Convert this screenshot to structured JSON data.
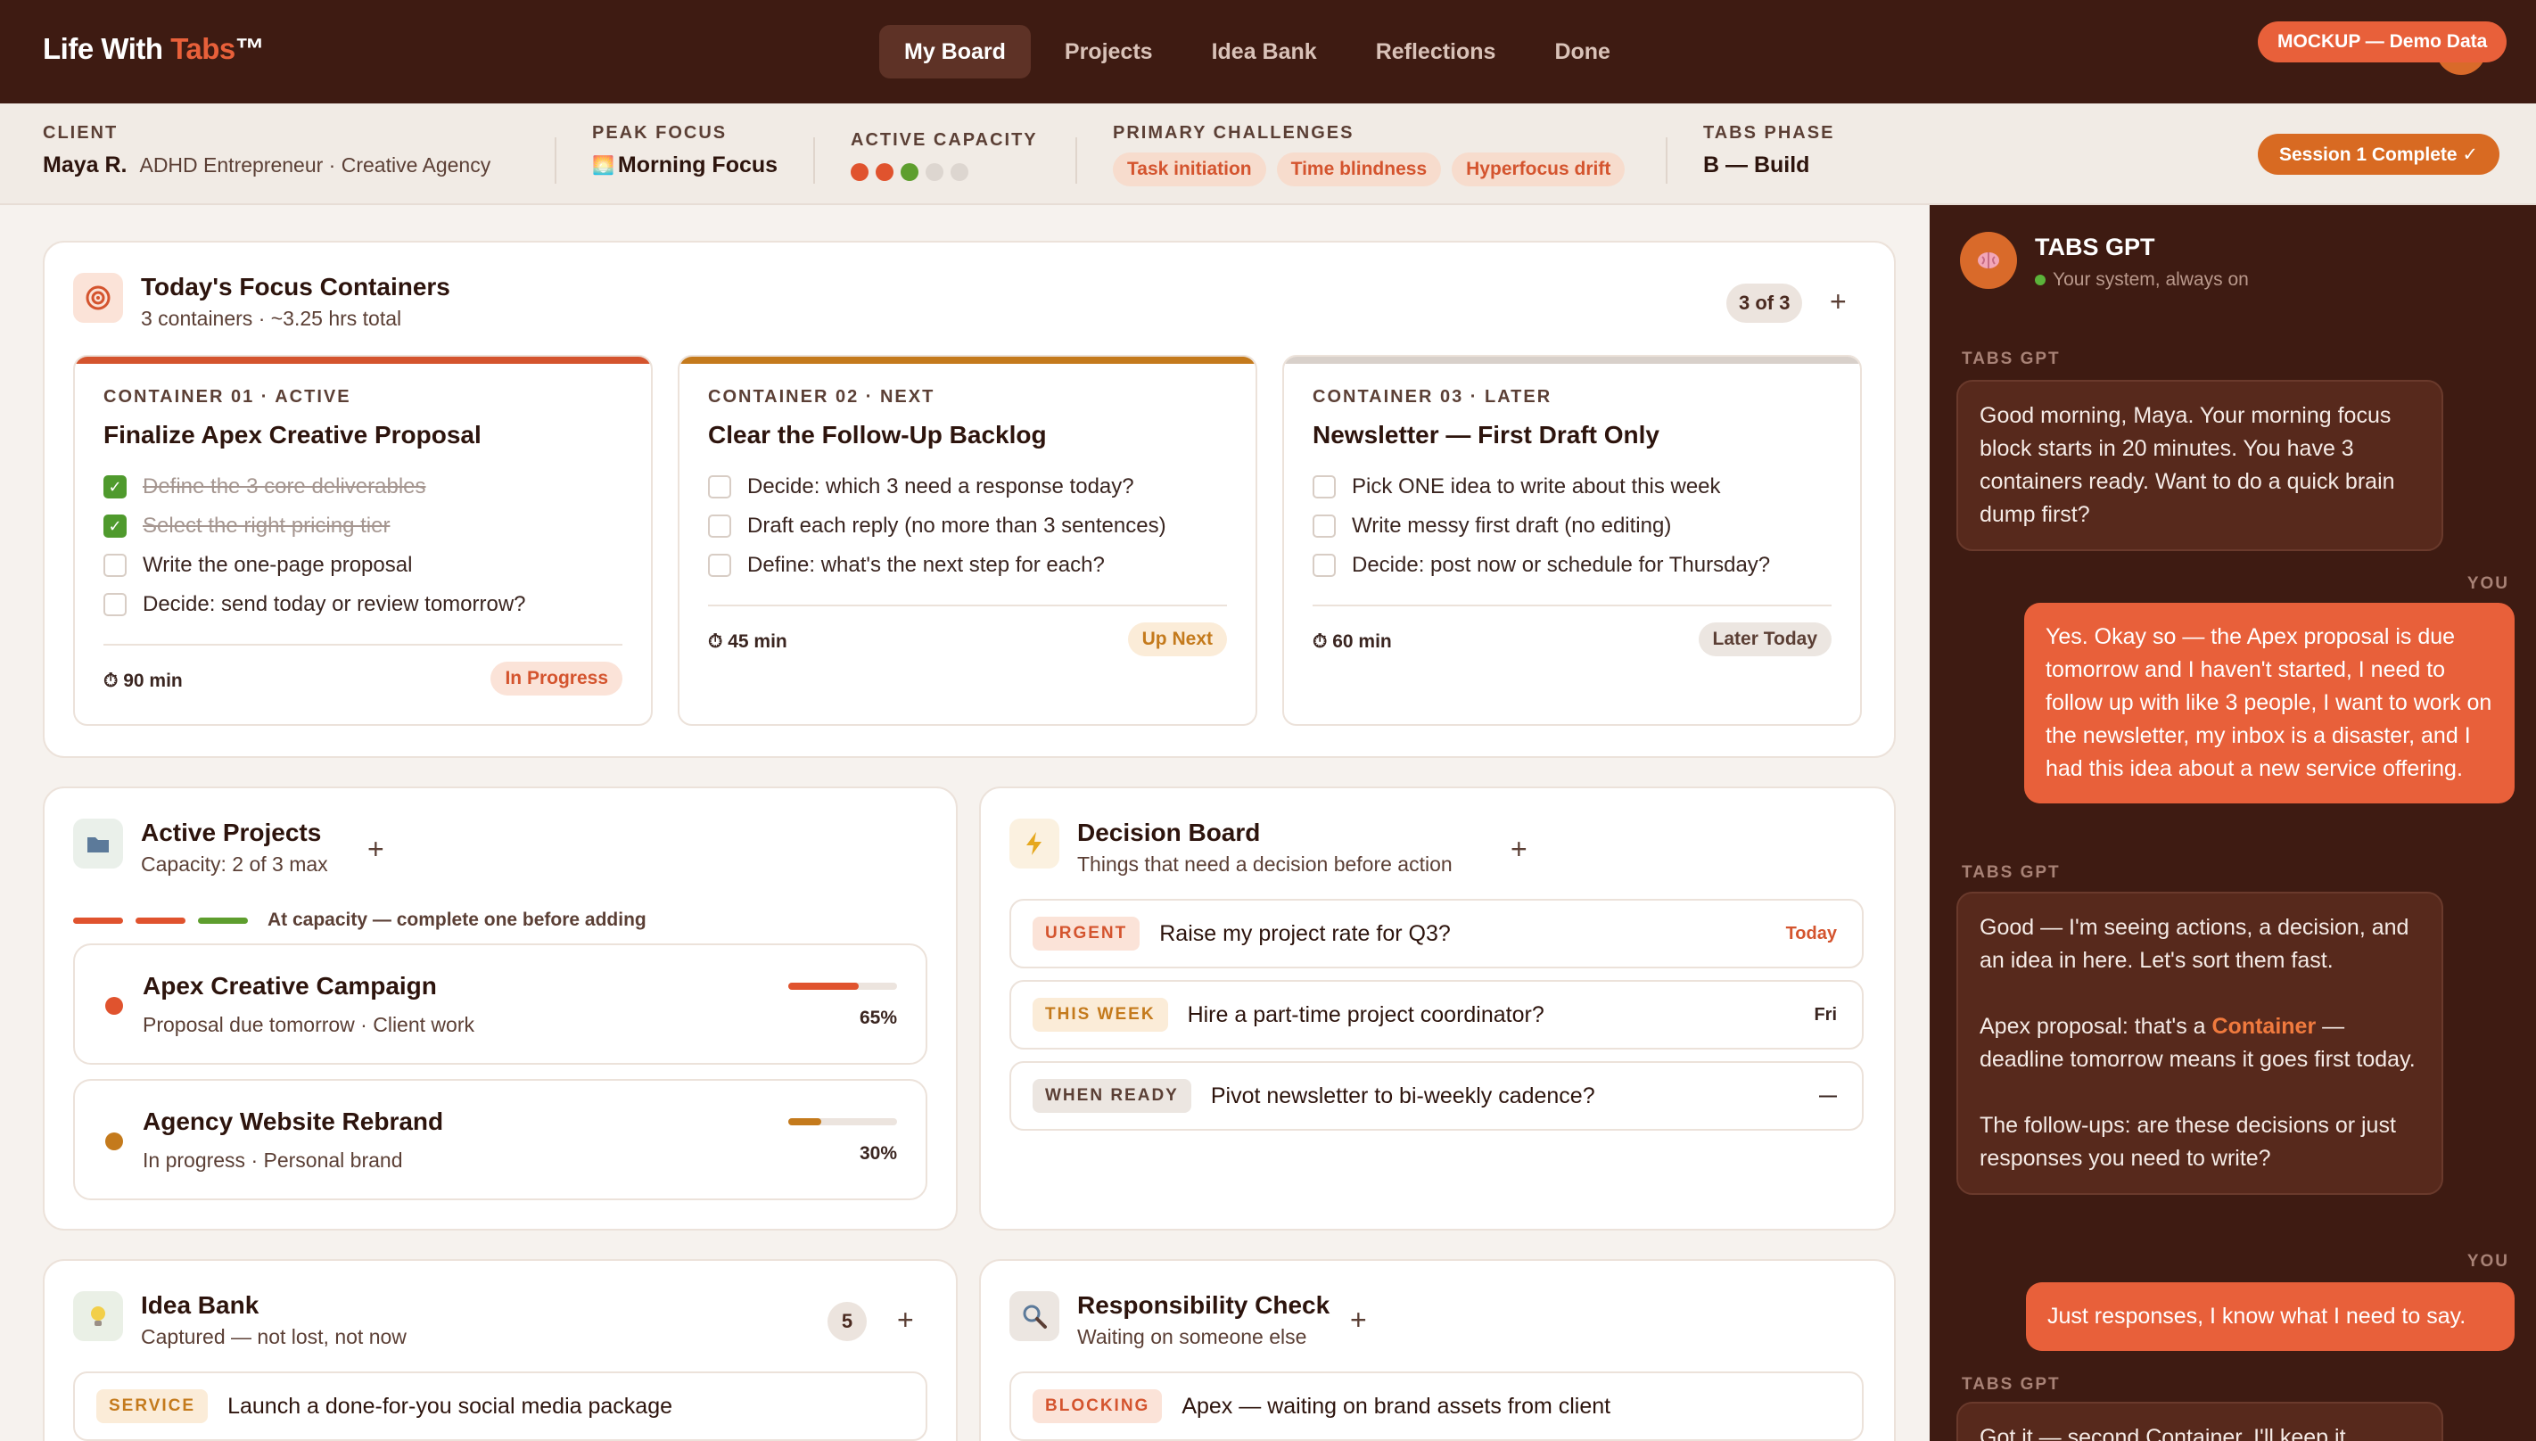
{
  "app": {
    "logo_prefix": "Life With ",
    "logo_accent": "Tabs",
    "logo_suffix": "™",
    "mockup_badge": "MOCKUP — Demo Data"
  },
  "nav": [
    {
      "label": "My Board",
      "active": true
    },
    {
      "label": "Projects",
      "active": false
    },
    {
      "label": "Idea Bank",
      "active": false
    },
    {
      "label": "Reflections",
      "active": false
    },
    {
      "label": "Done",
      "active": false
    }
  ],
  "client": {
    "label": "CLIENT",
    "name": "Maya R.",
    "description": "ADHD Entrepreneur · Creative Agency",
    "peak_label": "PEAK FOCUS",
    "peak_icon": "🌅",
    "peak_value": "Morning Focus",
    "capacity_label": "ACTIVE CAPACITY",
    "capacity_level": 3,
    "capacity_max": 5,
    "challenges_label": "PRIMARY CHALLENGES",
    "challenges": [
      "Task initiation",
      "Time blindness",
      "Hyperfocus drift"
    ],
    "phase_label": "TABS PHASE",
    "phase_value": "B — Build",
    "session_button": "Session 1 Complete ✓"
  },
  "focus": {
    "icon": "target-icon",
    "title": "Today's Focus Containers",
    "subtitle": "3 containers · ~3.25 hrs total",
    "count": "3 of 3",
    "add": "+",
    "containers": [
      {
        "label": "CONTAINER 01 · ACTIVE",
        "title": "Finalize Apex Creative Proposal",
        "accent": "#d4542e",
        "tasks": [
          {
            "text": "Define the 3 core deliverables",
            "done": true
          },
          {
            "text": "Select the right pricing tier",
            "done": true
          },
          {
            "text": "Write the one-page proposal",
            "done": false
          },
          {
            "text": "Decide: send today or review tomorrow?",
            "done": false
          }
        ],
        "time": "⏱ 90 min",
        "status": "In Progress",
        "status_bg": "#fbe3d8",
        "status_fg": "#d4542e"
      },
      {
        "label": "CONTAINER 02 · NEXT",
        "title": "Clear the Follow-Up Backlog",
        "accent": "#c47a1c",
        "tasks": [
          {
            "text": "Decide: which 3 need a response today?",
            "done": false
          },
          {
            "text": "Draft each reply (no more than 3 sentences)",
            "done": false
          },
          {
            "text": "Define: what's the next step for each?",
            "done": false
          }
        ],
        "time": "⏱ 45 min",
        "status": "Up Next",
        "status_bg": "#fbecd8",
        "status_fg": "#c47a1c"
      },
      {
        "label": "CONTAINER 03 · LATER",
        "title": "Newsletter — First Draft Only",
        "accent": "#d8d0ca",
        "tasks": [
          {
            "text": "Pick ONE idea to write about this week",
            "done": false
          },
          {
            "text": "Write messy first draft (no editing)",
            "done": false
          },
          {
            "text": "Decide: post now or schedule for Thursday?",
            "done": false
          }
        ],
        "time": "⏱ 60 min",
        "status": "Later Today",
        "status_bg": "#ece6e1",
        "status_fg": "#5b3f35"
      }
    ]
  },
  "projects": {
    "title": "Active Projects",
    "subtitle": "Capacity: 2 of 3 max",
    "add": "+",
    "capacity_note": "At capacity — complete one before adding",
    "items": [
      {
        "name": "Apex Creative Campaign",
        "sub": "Proposal due tomorrow · Client work",
        "progress": 0.65,
        "pct": "65%",
        "color": "#e0532e"
      },
      {
        "name": "Agency Website Rebrand",
        "sub": "In progress · Personal brand",
        "progress": 0.3,
        "pct": "30%",
        "color": "#c47a1c"
      }
    ]
  },
  "decisions": {
    "title": "Decision Board",
    "subtitle": "Things that need a decision before action",
    "add": "+",
    "items": [
      {
        "tag": "URGENT",
        "text": "Raise my project rate for Q3?",
        "when": "Today",
        "tag_bg": "#fbe3d8",
        "tag_fg": "#d4542e",
        "when_fg": "#d4542e"
      },
      {
        "tag": "THIS WEEK",
        "text": "Hire a part-time project coordinator?",
        "when": "Fri",
        "tag_bg": "#fbecd8",
        "tag_fg": "#c47a1c",
        "when_fg": "#3a2520"
      },
      {
        "tag": "WHEN READY",
        "text": "Pivot newsletter to bi-weekly cadence?",
        "when": "—",
        "tag_bg": "#ece6e1",
        "tag_fg": "#5b3f35",
        "when_fg": "#3a2520"
      }
    ]
  },
  "ideas": {
    "title": "Idea Bank",
    "subtitle": "Captured — not lost, not now",
    "count": "5",
    "add": "+",
    "items": [
      {
        "tag": "SERVICE",
        "text": "Launch a done-for-you social media package"
      }
    ]
  },
  "responsibility": {
    "title": "Responsibility Check",
    "subtitle": "Waiting on someone else",
    "add": "+",
    "items": [
      {
        "tag": "BLOCKING",
        "text": "Apex — waiting on brand assets from client"
      }
    ]
  },
  "chat": {
    "name": "TABS GPT",
    "status": "Your system, always on",
    "messages": [
      {
        "from": "TABS GPT",
        "text": "Good morning, Maya. Your morning focus block starts in 20 minutes. You have 3 containers ready. Want to do a quick brain dump first?"
      },
      {
        "from": "YOU",
        "text": "Yes. Okay so — the Apex proposal is due tomorrow and I haven't started, I need to follow up with like 3 people, I want to work on the newsletter, my inbox is a disaster, and I had this idea about a new service offering."
      },
      {
        "from": "TABS GPT",
        "p1": "Good — I'm seeing actions, a decision, and an idea in here. Let's sort them fast.",
        "p2a": "Apex proposal: that's a ",
        "p2b": "Container",
        "p2c": " — deadline tomorrow means it goes first today.",
        "p3": "The follow-ups: are these decisions or just responses you need to write?"
      },
      {
        "from": "YOU",
        "text": "Just responses, I know what I need to say."
      },
      {
        "from": "TABS GPT",
        "text": "Got it — second Container. I'll keep it"
      }
    ]
  }
}
